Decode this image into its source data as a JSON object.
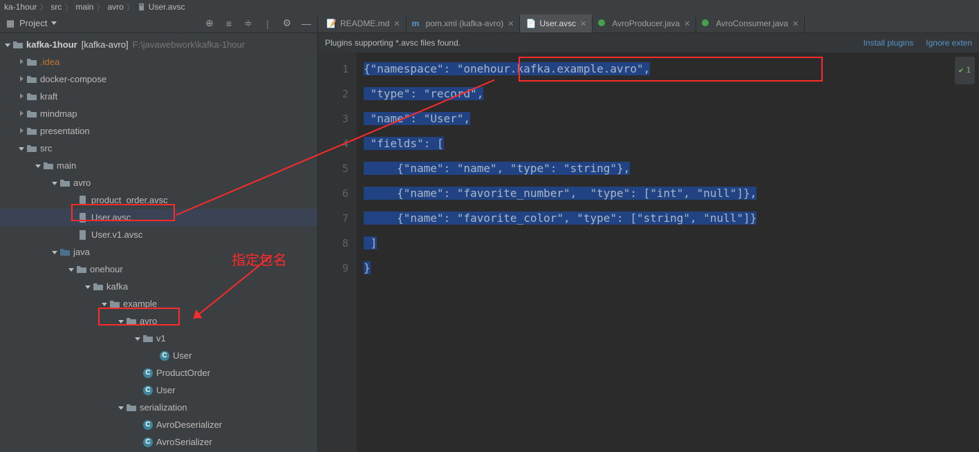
{
  "breadcrumb": {
    "p0": "ka-1hour",
    "p1": "src",
    "p2": "main",
    "p3": "avro",
    "file": "User.avsc"
  },
  "sidebar": {
    "title": "Project",
    "root": {
      "name": "kafka-1hour",
      "bracket": "[kafka-avro]",
      "path": "F:\\javawebwork\\kafka-1hour"
    },
    "idea": ".idea",
    "dc": "docker-compose",
    "kraft": "kraft",
    "mind": "mindmap",
    "pres": "presentation",
    "src": "src",
    "main": "main",
    "avro": "avro",
    "f1": "product_order.avsc",
    "f2": "User.avsc",
    "f3": "User.v1.avsc",
    "java": "java",
    "onehour": "onehour",
    "kafka": "kafka",
    "example": "example",
    "avro2": "avro",
    "v1": "v1",
    "c1": "User",
    "c2": "ProductOrder",
    "c3": "User",
    "ser": "serialization",
    "d1": "AvroDeserializer",
    "d2": "AvroSerializer"
  },
  "tabs": {
    "readme": "README.md",
    "pom": "pom.xml (kafka-avro)",
    "user": "User.avsc",
    "prod": "AvroProducer.java",
    "cons": "AvroConsumer.java"
  },
  "notice": {
    "msg": "Plugins supporting *.avsc files found.",
    "install": "Install plugins",
    "ignore": "Ignore exten"
  },
  "code": {
    "l1": "{\"namespace\": \"onehour.kafka.example.avro\",",
    "l2": " \"type\": \"record\",",
    "l3": " \"name\": \"User\",",
    "l4": " \"fields\": [",
    "l5": "     {\"name\": \"name\", \"type\": \"string\"},",
    "l6": "     {\"name\": \"favorite_number\",  \"type\": [\"int\", \"null\"]},",
    "l7": "     {\"name\": \"favorite_color\", \"type\": [\"string\", \"null\"]}",
    "l8": " ]",
    "l9": "}"
  },
  "inspect": "1",
  "annot": "指定包名",
  "chart_data": {
    "type": "table",
    "title": "User.avsc schema",
    "namespace": "onehour.kafka.example.avro",
    "record_name": "User",
    "fields": [
      {
        "name": "name",
        "type": "string"
      },
      {
        "name": "favorite_number",
        "type": [
          "int",
          "null"
        ]
      },
      {
        "name": "favorite_color",
        "type": [
          "string",
          "null"
        ]
      }
    ]
  }
}
